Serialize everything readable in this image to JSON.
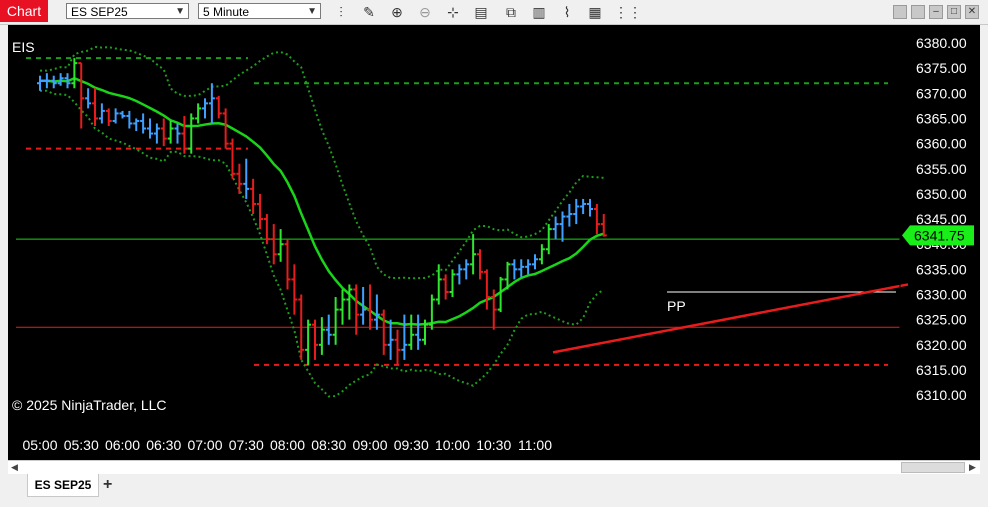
{
  "window": {
    "tab_label": "Chart"
  },
  "toolbar": {
    "instrument": "ES SEP25",
    "interval": "5 Minute",
    "tools": [
      "bar-type-icon",
      "pencil-icon",
      "zoom-in-icon",
      "zoom-out-icon",
      "crosshair-icon",
      "data-box-icon",
      "indicators-icon",
      "strategies-icon",
      "properties-icon",
      "grid-icon"
    ]
  },
  "chart": {
    "instrument_label": "EIS",
    "copyright": "© 2025 NinjaTrader, LLC",
    "last_price": "6341.75",
    "pivot_label": "PP",
    "price_ticks": [
      "6380.00",
      "6375.00",
      "6370.00",
      "6365.00",
      "6360.00",
      "6355.00",
      "6350.00",
      "6345.00",
      "6340.00",
      "6335.00",
      "6330.00",
      "6325.00",
      "6320.00",
      "6315.00",
      "6310.00"
    ],
    "time_ticks": [
      "05:00",
      "05:30",
      "06:00",
      "06:30",
      "07:00",
      "07:30",
      "08:00",
      "08:30",
      "09:00",
      "09:30",
      "10:00",
      "10:30",
      "11:00"
    ]
  },
  "colors": {
    "up": "#2ee62e",
    "down": "#e81c1c",
    "neutral": "#3fa0ff",
    "ma": "#19d419",
    "bands": "#1d9e1d",
    "pivot": "#ffffff",
    "support": "#e81c1c",
    "last_price_bg": "#19ee19"
  },
  "tabs": {
    "instrument_tab": "ES SEP25",
    "add_tab": "+"
  },
  "chart_data": {
    "type": "candlestick",
    "title": "",
    "x_range": [
      "04:55",
      "11:20"
    ],
    "y_range": [
      6307.5,
      6381
    ],
    "last": 6341.75,
    "horizontal_lines": [
      {
        "value": 6341.0,
        "color": "#19d419"
      },
      {
        "value": 6323.5,
        "color": "#e81c1c"
      },
      {
        "value": 6330.5,
        "color": "#ffffff",
        "label": "PP"
      }
    ],
    "bars": [
      {
        "t": "05:00",
        "o": 6372.0,
        "h": 6373.5,
        "l": 6370.5,
        "c": 6372.5
      },
      {
        "t": "05:05",
        "o": 6372.5,
        "h": 6374.0,
        "l": 6371.0,
        "c": 6372.5
      },
      {
        "t": "05:10",
        "o": 6372.5,
        "h": 6373.5,
        "l": 6371.0,
        "c": 6372.0
      },
      {
        "t": "05:15",
        "o": 6372.0,
        "h": 6374.0,
        "l": 6371.5,
        "c": 6373.0
      },
      {
        "t": "05:20",
        "o": 6373.0,
        "h": 6374.0,
        "l": 6371.0,
        "c": 6372.0
      },
      {
        "t": "05:25",
        "o": 6372.0,
        "h": 6377.0,
        "l": 6371.0,
        "c": 6376.0
      },
      {
        "t": "05:30",
        "o": 6376.0,
        "h": 6376.0,
        "l": 6363.0,
        "c": 6369.0
      },
      {
        "t": "05:35",
        "o": 6369.0,
        "h": 6371.0,
        "l": 6367.0,
        "c": 6368.0
      },
      {
        "t": "05:40",
        "o": 6368.0,
        "h": 6371.0,
        "l": 6363.5,
        "c": 6365.0
      },
      {
        "t": "05:45",
        "o": 6365.0,
        "h": 6368.0,
        "l": 6364.0,
        "c": 6366.5
      },
      {
        "t": "05:50",
        "o": 6366.5,
        "h": 6367.0,
        "l": 6363.5,
        "c": 6364.5
      },
      {
        "t": "05:55",
        "o": 6364.5,
        "h": 6367.0,
        "l": 6364.0,
        "c": 6366.0
      },
      {
        "t": "06:00",
        "o": 6366.0,
        "h": 6366.5,
        "l": 6365.0,
        "c": 6365.5
      },
      {
        "t": "06:05",
        "o": 6365.5,
        "h": 6366.5,
        "l": 6363.0,
        "c": 6364.0
      },
      {
        "t": "06:10",
        "o": 6364.0,
        "h": 6365.0,
        "l": 6362.5,
        "c": 6364.5
      },
      {
        "t": "06:15",
        "o": 6364.5,
        "h": 6366.0,
        "l": 6362.0,
        "c": 6363.0
      },
      {
        "t": "06:20",
        "o": 6363.0,
        "h": 6365.0,
        "l": 6361.0,
        "c": 6362.0
      },
      {
        "t": "06:25",
        "o": 6362.0,
        "h": 6364.0,
        "l": 6360.0,
        "c": 6363.0
      },
      {
        "t": "06:30",
        "o": 6363.0,
        "h": 6365.0,
        "l": 6359.5,
        "c": 6361.0
      },
      {
        "t": "06:35",
        "o": 6361.0,
        "h": 6364.5,
        "l": 6360.0,
        "c": 6363.0
      },
      {
        "t": "06:40",
        "o": 6363.0,
        "h": 6364.0,
        "l": 6360.0,
        "c": 6362.0
      },
      {
        "t": "06:45",
        "o": 6362.0,
        "h": 6365.5,
        "l": 6358.0,
        "c": 6359.0
      },
      {
        "t": "06:50",
        "o": 6359.0,
        "h": 6366.0,
        "l": 6358.0,
        "c": 6365.0
      },
      {
        "t": "06:55",
        "o": 6365.0,
        "h": 6368.0,
        "l": 6364.0,
        "c": 6367.0
      },
      {
        "t": "07:00",
        "o": 6367.0,
        "h": 6369.0,
        "l": 6365.0,
        "c": 6368.0
      },
      {
        "t": "07:05",
        "o": 6368.0,
        "h": 6372.0,
        "l": 6364.0,
        "c": 6369.0
      },
      {
        "t": "07:10",
        "o": 6369.0,
        "h": 6369.5,
        "l": 6365.0,
        "c": 6366.0
      },
      {
        "t": "07:15",
        "o": 6366.0,
        "h": 6367.0,
        "l": 6359.0,
        "c": 6360.0
      },
      {
        "t": "07:20",
        "o": 6360.0,
        "h": 6361.0,
        "l": 6353.0,
        "c": 6354.0
      },
      {
        "t": "07:25",
        "o": 6354.0,
        "h": 6356.0,
        "l": 6350.0,
        "c": 6352.0
      },
      {
        "t": "07:30",
        "o": 6352.0,
        "h": 6357.0,
        "l": 6349.0,
        "c": 6351.0
      },
      {
        "t": "07:35",
        "o": 6351.0,
        "h": 6353.0,
        "l": 6346.0,
        "c": 6348.0
      },
      {
        "t": "07:40",
        "o": 6348.0,
        "h": 6350.0,
        "l": 6343.0,
        "c": 6345.0
      },
      {
        "t": "07:45",
        "o": 6345.0,
        "h": 6346.0,
        "l": 6340.0,
        "c": 6341.0
      },
      {
        "t": "07:50",
        "o": 6341.0,
        "h": 6344.0,
        "l": 6336.0,
        "c": 6338.0
      },
      {
        "t": "07:55",
        "o": 6338.0,
        "h": 6343.0,
        "l": 6336.5,
        "c": 6340.0
      },
      {
        "t": "08:00",
        "o": 6340.0,
        "h": 6341.0,
        "l": 6331.0,
        "c": 6333.0
      },
      {
        "t": "08:05",
        "o": 6333.0,
        "h": 6336.0,
        "l": 6326.0,
        "c": 6329.0
      },
      {
        "t": "08:10",
        "o": 6329.0,
        "h": 6330.0,
        "l": 6317.0,
        "c": 6319.0
      },
      {
        "t": "08:15",
        "o": 6319.0,
        "h": 6325.0,
        "l": 6316.0,
        "c": 6324.0
      },
      {
        "t": "08:20",
        "o": 6324.0,
        "h": 6325.0,
        "l": 6317.0,
        "c": 6320.0
      },
      {
        "t": "08:25",
        "o": 6320.0,
        "h": 6325.5,
        "l": 6318.0,
        "c": 6323.0
      },
      {
        "t": "08:30",
        "o": 6323.0,
        "h": 6326.0,
        "l": 6320.0,
        "c": 6322.0
      },
      {
        "t": "08:35",
        "o": 6322.0,
        "h": 6329.5,
        "l": 6320.0,
        "c": 6327.0
      },
      {
        "t": "08:40",
        "o": 6327.0,
        "h": 6331.0,
        "l": 6324.0,
        "c": 6329.0
      },
      {
        "t": "08:45",
        "o": 6329.0,
        "h": 6332.0,
        "l": 6325.0,
        "c": 6331.0
      },
      {
        "t": "08:50",
        "o": 6331.0,
        "h": 6332.0,
        "l": 6322.0,
        "c": 6326.0
      },
      {
        "t": "08:55",
        "o": 6326.0,
        "h": 6331.5,
        "l": 6324.0,
        "c": 6327.0
      },
      {
        "t": "09:00",
        "o": 6327.0,
        "h": 6332.0,
        "l": 6323.0,
        "c": 6325.0
      },
      {
        "t": "09:05",
        "o": 6325.0,
        "h": 6330.0,
        "l": 6323.0,
        "c": 6326.0
      },
      {
        "t": "09:10",
        "o": 6326.0,
        "h": 6327.0,
        "l": 6318.0,
        "c": 6320.0
      },
      {
        "t": "09:15",
        "o": 6320.0,
        "h": 6325.0,
        "l": 6317.0,
        "c": 6321.0
      },
      {
        "t": "09:20",
        "o": 6321.0,
        "h": 6323.0,
        "l": 6316.0,
        "c": 6319.0
      },
      {
        "t": "09:25",
        "o": 6319.0,
        "h": 6326.0,
        "l": 6317.0,
        "c": 6320.0
      },
      {
        "t": "09:30",
        "o": 6320.0,
        "h": 6326.0,
        "l": 6319.0,
        "c": 6322.0
      },
      {
        "t": "09:35",
        "o": 6322.0,
        "h": 6326.0,
        "l": 6319.0,
        "c": 6321.0
      },
      {
        "t": "09:40",
        "o": 6321.0,
        "h": 6325.0,
        "l": 6320.0,
        "c": 6324.0
      },
      {
        "t": "09:45",
        "o": 6324.0,
        "h": 6330.0,
        "l": 6323.0,
        "c": 6329.0
      },
      {
        "t": "09:50",
        "o": 6329.0,
        "h": 6336.0,
        "l": 6328.0,
        "c": 6333.0
      },
      {
        "t": "09:55",
        "o": 6333.0,
        "h": 6334.0,
        "l": 6329.0,
        "c": 6330.5
      },
      {
        "t": "10:00",
        "o": 6330.5,
        "h": 6335.0,
        "l": 6329.5,
        "c": 6334.0
      },
      {
        "t": "10:05",
        "o": 6334.0,
        "h": 6336.0,
        "l": 6332.0,
        "c": 6335.0
      },
      {
        "t": "10:10",
        "o": 6335.0,
        "h": 6337.0,
        "l": 6333.0,
        "c": 6336.0
      },
      {
        "t": "10:15",
        "o": 6336.0,
        "h": 6342.0,
        "l": 6334.0,
        "c": 6338.0
      },
      {
        "t": "10:20",
        "o": 6338.0,
        "h": 6339.0,
        "l": 6333.0,
        "c": 6334.5
      },
      {
        "t": "10:25",
        "o": 6334.5,
        "h": 6335.0,
        "l": 6327.0,
        "c": 6329.5
      },
      {
        "t": "10:30",
        "o": 6329.5,
        "h": 6331.0,
        "l": 6323.0,
        "c": 6327.0
      },
      {
        "t": "10:35",
        "o": 6327.0,
        "h": 6333.5,
        "l": 6326.5,
        "c": 6333.0
      },
      {
        "t": "10:40",
        "o": 6333.0,
        "h": 6336.5,
        "l": 6331.0,
        "c": 6336.0
      },
      {
        "t": "10:45",
        "o": 6336.0,
        "h": 6337.0,
        "l": 6333.0,
        "c": 6335.0
      },
      {
        "t": "10:50",
        "o": 6335.0,
        "h": 6337.0,
        "l": 6333.5,
        "c": 6335.5
      },
      {
        "t": "10:55",
        "o": 6335.5,
        "h": 6337.0,
        "l": 6334.0,
        "c": 6336.0
      },
      {
        "t": "11:00",
        "o": 6336.0,
        "h": 6338.0,
        "l": 6335.0,
        "c": 6337.0
      },
      {
        "t": "11:05",
        "o": 6337.0,
        "h": 6340.0,
        "l": 6336.0,
        "c": 6339.0
      },
      {
        "t": "11:10",
        "o": 6339.0,
        "h": 6344.0,
        "l": 6338.0,
        "c": 6343.0
      },
      {
        "t": "11:15",
        "o": 6343.0,
        "h": 6345.5,
        "l": 6341.0,
        "c": 6344.0
      },
      {
        "t": "11:20",
        "o": 6344.0,
        "h": 6346.5,
        "l": 6340.5,
        "c": 6345.5
      },
      {
        "t": "11:25",
        "o": 6345.5,
        "h": 6348.0,
        "l": 6343.5,
        "c": 6346.0
      },
      {
        "t": "11:30",
        "o": 6346.0,
        "h": 6349.0,
        "l": 6344.0,
        "c": 6347.5
      },
      {
        "t": "11:35",
        "o": 6347.5,
        "h": 6349.0,
        "l": 6346.0,
        "c": 6348.0
      },
      {
        "t": "11:40",
        "o": 6348.0,
        "h": 6349.0,
        "l": 6345.5,
        "c": 6347.0
      },
      {
        "t": "11:45",
        "o": 6347.0,
        "h": 6348.0,
        "l": 6342.0,
        "c": 6344.0
      },
      {
        "t": "11:50",
        "o": 6344.0,
        "h": 6346.0,
        "l": 6341.5,
        "c": 6341.75
      }
    ]
  }
}
